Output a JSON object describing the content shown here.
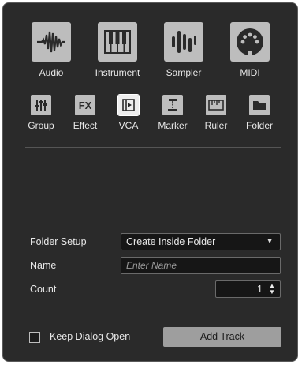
{
  "track_types": [
    {
      "label": "Audio",
      "icon": "audio-waveform-icon"
    },
    {
      "label": "Instrument",
      "icon": "piano-keys-icon"
    },
    {
      "label": "Sampler",
      "icon": "sampler-bars-icon"
    },
    {
      "label": "MIDI",
      "icon": "midi-connector-icon"
    }
  ],
  "small_types": [
    {
      "label": "Group",
      "icon": "group-faders-icon"
    },
    {
      "label": "Effect",
      "icon": "fx-icon",
      "glyph": "FX"
    },
    {
      "label": "VCA",
      "icon": "vca-icon"
    },
    {
      "label": "Marker",
      "icon": "marker-icon"
    },
    {
      "label": "Ruler",
      "icon": "ruler-icon"
    },
    {
      "label": "Folder",
      "icon": "folder-icon"
    }
  ],
  "form": {
    "folder_setup_label": "Folder Setup",
    "folder_setup_value": "Create Inside Folder",
    "name_label": "Name",
    "name_placeholder": "Enter Name",
    "count_label": "Count",
    "count_value": "1"
  },
  "footer": {
    "keep_open_label": "Keep Dialog Open",
    "add_track_label": "Add Track"
  },
  "colors": {
    "background": "#2a2a2a",
    "icon": "#bdbdbd",
    "selected": "#eeeeee"
  }
}
